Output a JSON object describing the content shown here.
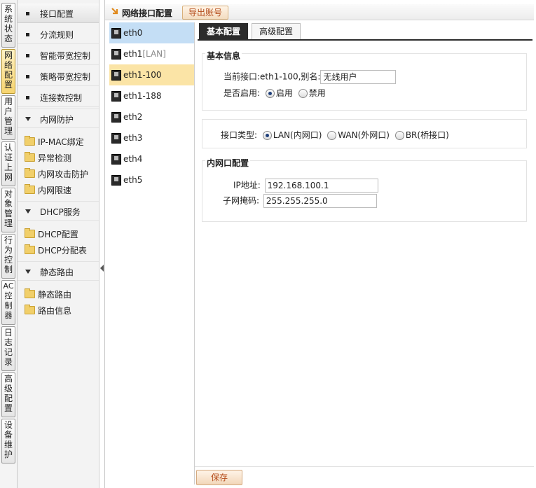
{
  "vertical_tabs": [
    {
      "label": "系统状态",
      "active": false
    },
    {
      "label": "网络配置",
      "active": true
    },
    {
      "label": "用户管理",
      "active": false
    },
    {
      "label": "认证上网",
      "active": false
    },
    {
      "label": "对象管理",
      "active": false
    },
    {
      "label": "行为控制",
      "active": false
    },
    {
      "label": "AC控制器",
      "active": false
    },
    {
      "label": "日志记录",
      "active": false
    },
    {
      "label": "高级配置",
      "active": false
    },
    {
      "label": "设备维护",
      "active": false
    }
  ],
  "submenu": {
    "items": [
      "接口配置",
      "分流规则",
      "智能带宽控制",
      "策略带宽控制",
      "连接数控制"
    ],
    "groups": [
      {
        "label": "内网防护",
        "leaves": [
          "IP-MAC绑定",
          "异常检测",
          "内网攻击防护",
          "内网限速"
        ]
      },
      {
        "label": "DHCP服务",
        "leaves": [
          "DHCP配置",
          "DHCP分配表"
        ]
      },
      {
        "label": "静态路由",
        "leaves": [
          "静态路由",
          "路由信息"
        ]
      }
    ]
  },
  "header": {
    "title": "网络接口配置",
    "export_label": "导出账号"
  },
  "interfaces": [
    {
      "name": "eth0",
      "tag": ""
    },
    {
      "name": "eth1",
      "tag": "[LAN]"
    },
    {
      "name": "eth1-100",
      "tag": ""
    },
    {
      "name": "eth1-188",
      "tag": ""
    },
    {
      "name": "eth2",
      "tag": ""
    },
    {
      "name": "eth3",
      "tag": ""
    },
    {
      "name": "eth4",
      "tag": ""
    },
    {
      "name": "eth5",
      "tag": ""
    }
  ],
  "tabs": {
    "basic": "基本配置",
    "advanced": "高级配置"
  },
  "basic_info": {
    "section_title": "基本信息",
    "current_iface_label": "当前接口:eth1-100,别名:",
    "alias_value": "无线用户",
    "enable_label": "是否启用:",
    "enable_on": "启用",
    "enable_off": "禁用"
  },
  "iface_type": {
    "label": "接口类型:",
    "lan": "LAN(内网口)",
    "wan": "WAN(外网口)",
    "br": "BR(桥接口)"
  },
  "lan_config": {
    "section_title": "内网口配置",
    "ip_label": "IP地址:",
    "ip_value": "192.168.100.1",
    "mask_label": "子网掩码:",
    "mask_value": "255.255.255.0"
  },
  "footer": {
    "save_label": "保存"
  }
}
